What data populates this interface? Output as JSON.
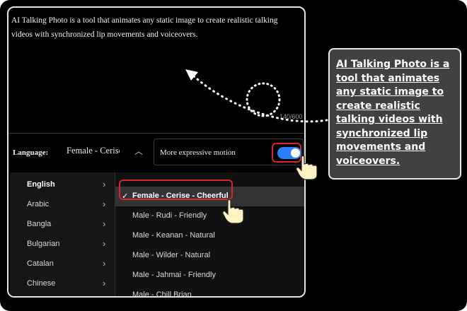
{
  "textarea": {
    "text": "AI Talking Photo is a tool that animates any static image to create realistic talking videos with synchronized lip movements and voiceovers.",
    "counter": "140/600"
  },
  "language_selector": {
    "label": "Language:",
    "value": "Female - Cerise - Cheerful",
    "chevron_icon": "chevron-up-icon"
  },
  "motion": {
    "label": "More expressive motion",
    "enabled": true,
    "accent": "#2d7ff9"
  },
  "dropdown": {
    "languages": [
      {
        "label": "English",
        "active": true
      },
      {
        "label": "Arabic",
        "active": false
      },
      {
        "label": "Bangla",
        "active": false
      },
      {
        "label": "Bulgarian",
        "active": false
      },
      {
        "label": "Catalan",
        "active": false
      },
      {
        "label": "Chinese",
        "active": false
      }
    ],
    "voices": [
      {
        "label": "Female - Cerise - Cheerful",
        "selected": true
      },
      {
        "label": "Male - Rudi - Friendly",
        "selected": false
      },
      {
        "label": "Male - Keanan - Natural",
        "selected": false
      },
      {
        "label": "Male - Wilder - Natural",
        "selected": false
      },
      {
        "label": "Male - Jahmai - Friendly",
        "selected": false
      },
      {
        "label": "Male - Chill Brian",
        "selected": false
      }
    ],
    "check_icon": "✓",
    "chevron_icon": "›"
  },
  "callout": {
    "text": "AI Talking Photo is a tool that animates any static image to create realistic talking videos with synchronized lip movements and voiceovers."
  },
  "highlight_color": "#d8242b"
}
